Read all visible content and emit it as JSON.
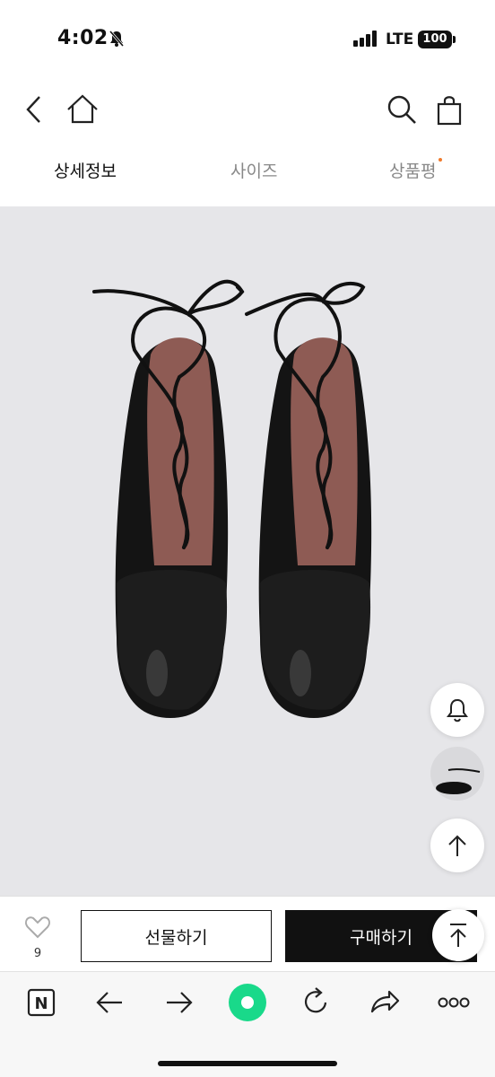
{
  "status_bar": {
    "time": "4:02",
    "network": "LTE",
    "battery": "100"
  },
  "tabs": [
    {
      "label": "상세정보",
      "active": true
    },
    {
      "label": "사이즈",
      "active": false
    },
    {
      "label": "상품평",
      "active": false,
      "has_dot": true
    }
  ],
  "product": {
    "wishlist_count": "9"
  },
  "actions": {
    "gift_label": "선물하기",
    "buy_label": "구매하기"
  },
  "toolbar": {
    "tab_icon_letter": "N"
  },
  "colors": {
    "accent_green": "#19d98a",
    "tab_dot": "#f07a2c",
    "buy_button": "#111111"
  }
}
